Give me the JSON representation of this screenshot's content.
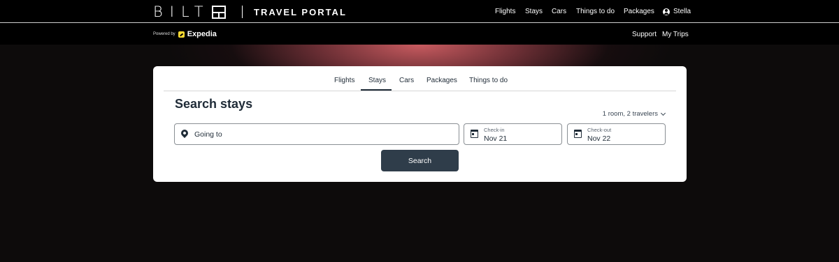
{
  "header": {
    "logo_text": "BILT",
    "portal_title": "TRAVEL PORTAL",
    "nav": [
      "Flights",
      "Stays",
      "Cars",
      "Things to do",
      "Packages"
    ],
    "user_name": "Stella"
  },
  "subheader": {
    "powered_by": "Powered by",
    "partner": "Expedia",
    "links": [
      "Support",
      "My Trips"
    ]
  },
  "search_card": {
    "tabs": [
      "Flights",
      "Stays",
      "Cars",
      "Packages",
      "Things to do"
    ],
    "active_tab": "Stays",
    "title": "Search stays",
    "travelers": "1 room, 2 travelers",
    "destination_placeholder": "Going to",
    "checkin_label": "Check-in",
    "checkin_value": "Nov 21",
    "checkout_label": "Check-out",
    "checkout_value": "Nov 22",
    "search_button": "Search"
  },
  "colors": {
    "background": "#000000",
    "glow": "#d25f64",
    "button": "#2f3d4a",
    "text_dark": "#1f2b37",
    "expedia_yellow": "#fddb32"
  }
}
